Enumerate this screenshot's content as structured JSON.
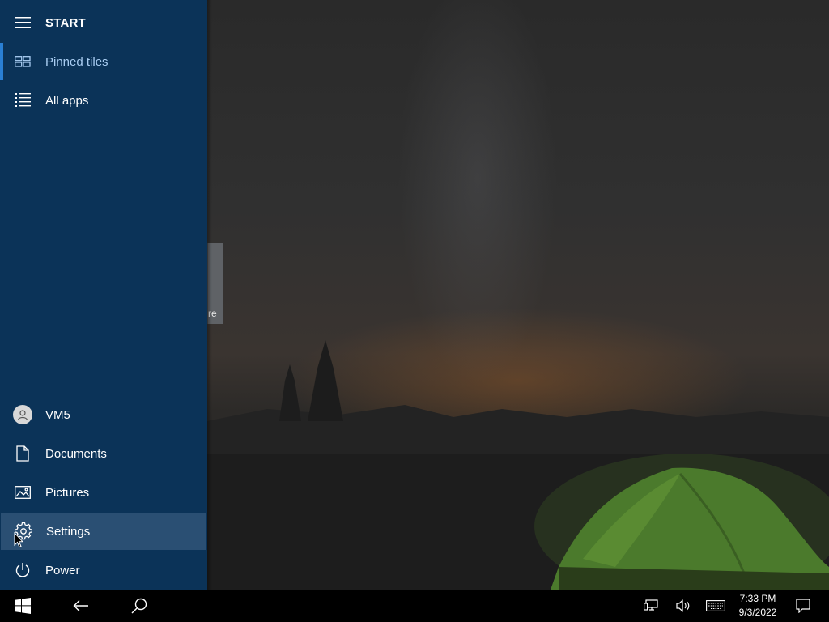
{
  "start_menu": {
    "title": "START",
    "top_items": [
      {
        "label": "Pinned tiles",
        "icon": "pinned-tiles-icon",
        "selected": true
      },
      {
        "label": "All apps",
        "icon": "all-apps-icon",
        "selected": false
      }
    ],
    "bottom_items": [
      {
        "label": "VM5",
        "icon": "user-avatar-icon"
      },
      {
        "label": "Documents",
        "icon": "document-icon"
      },
      {
        "label": "Pictures",
        "icon": "pictures-icon"
      },
      {
        "label": "Settings",
        "icon": "gear-icon",
        "hovered": true
      },
      {
        "label": "Power",
        "icon": "power-icon"
      }
    ]
  },
  "background_tile": {
    "partial_text": "re"
  },
  "taskbar": {
    "time": "7:33 PM",
    "date": "9/3/2022",
    "icons": [
      "windows-start-icon",
      "back-arrow-icon",
      "search-icon",
      "network-icon",
      "volume-icon",
      "keyboard-icon",
      "action-center-icon"
    ]
  },
  "colors": {
    "start_panel": "#0b3358",
    "accent": "#2a7fd3",
    "hover": "#2a4f73",
    "taskbar": "#000000"
  }
}
